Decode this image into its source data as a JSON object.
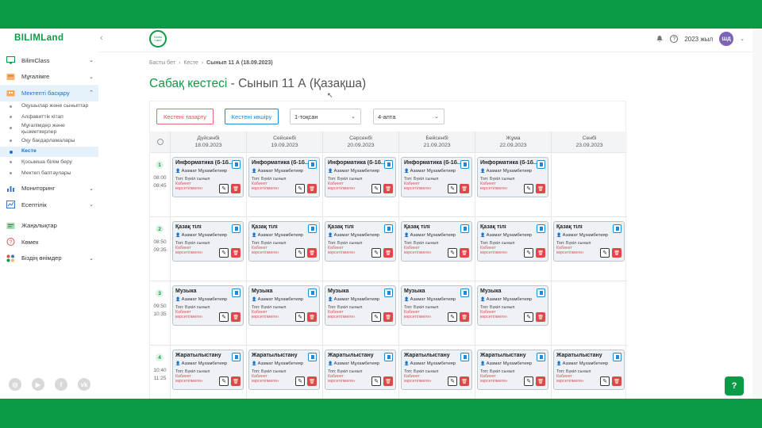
{
  "brand": {
    "logo": "BILIMLand",
    "emblem": "Білім Land"
  },
  "sidebar": {
    "items": [
      {
        "label": "BilimClass",
        "icon": "monitor-icon",
        "chevron": true
      },
      {
        "label": "Мұғалімге",
        "icon": "apple-icon",
        "chevron": true
      },
      {
        "label": "Мектепті басқару",
        "icon": "building-icon",
        "chevron": true,
        "active": true
      }
    ],
    "subitems": [
      {
        "label": "Оқушылар және сыныптар"
      },
      {
        "label": "Алфавиттік кітап"
      },
      {
        "label": "Мұғалімдер және қызметкерлер"
      },
      {
        "label": "Оқу бағдарламалары"
      },
      {
        "label": "Кесте",
        "active": true
      },
      {
        "label": "Қосымша білім беру"
      },
      {
        "label": "Мектеп баптаулары"
      }
    ],
    "items2": [
      {
        "label": "Мониторинг",
        "icon": "chart-icon",
        "chevron": true
      },
      {
        "label": "Есептілік",
        "icon": "report-icon",
        "chevron": true
      },
      {
        "label": "Жаңалықтар",
        "icon": "news-icon",
        "chevron": false
      },
      {
        "label": "Көмек",
        "icon": "help-icon",
        "chevron": false
      },
      {
        "label": "Біздің өнімдер",
        "icon": "apps-icon",
        "chevron": true
      }
    ],
    "socials": [
      "instagram-icon",
      "youtube-icon",
      "facebook-icon",
      "vk-icon"
    ]
  },
  "header": {
    "year": "2023 жыл",
    "avatar": "ШД"
  },
  "breadcrumb": {
    "home": "Басты бет",
    "schedule": "Кесте",
    "current": "Сынып 11 А (18.09.2023)"
  },
  "page": {
    "title": "Сабақ кестесі",
    "subtitle": " - Сынып 11 А (Қазақша)"
  },
  "toolbar": {
    "clear_label": "Кестені тазарту",
    "copy_label": "Кестені көшіру",
    "quarter": "1-тоқсан",
    "week": "4-апта"
  },
  "days": [
    {
      "name": "Дүйсенбі",
      "date": "18.09.2023"
    },
    {
      "name": "Сейсенбі",
      "date": "19.09.2023"
    },
    {
      "name": "Сәрсенбі",
      "date": "20.09.2023"
    },
    {
      "name": "Бейсенбі",
      "date": "21.09.2023"
    },
    {
      "name": "Жұма",
      "date": "22.09.2023"
    },
    {
      "name": "Сенбі",
      "date": "23.09.2023"
    }
  ],
  "lesson_common": {
    "teacher": "Азамат Мұхамбетияр",
    "group": "Топ: Бүкіл сынып",
    "room": "Кабинет көрсетілмеген"
  },
  "rows": [
    {
      "num": "1",
      "start": "08:00",
      "end": "08:45",
      "subject": "Информатика (б-1б...",
      "days": [
        true,
        true,
        true,
        true,
        true,
        false
      ]
    },
    {
      "num": "2",
      "start": "08:50",
      "end": "09:35",
      "subject": "Қазақ тілі",
      "days": [
        true,
        true,
        true,
        true,
        true,
        true
      ]
    },
    {
      "num": "3",
      "start": "09:50",
      "end": "10:35",
      "subject": "Музыка",
      "days": [
        true,
        true,
        true,
        true,
        true,
        false
      ]
    },
    {
      "num": "4",
      "start": "10:40",
      "end": "11:25",
      "subject": "Жаратылыстану",
      "days": [
        true,
        true,
        true,
        true,
        true,
        true
      ]
    }
  ],
  "fab_label": "?"
}
